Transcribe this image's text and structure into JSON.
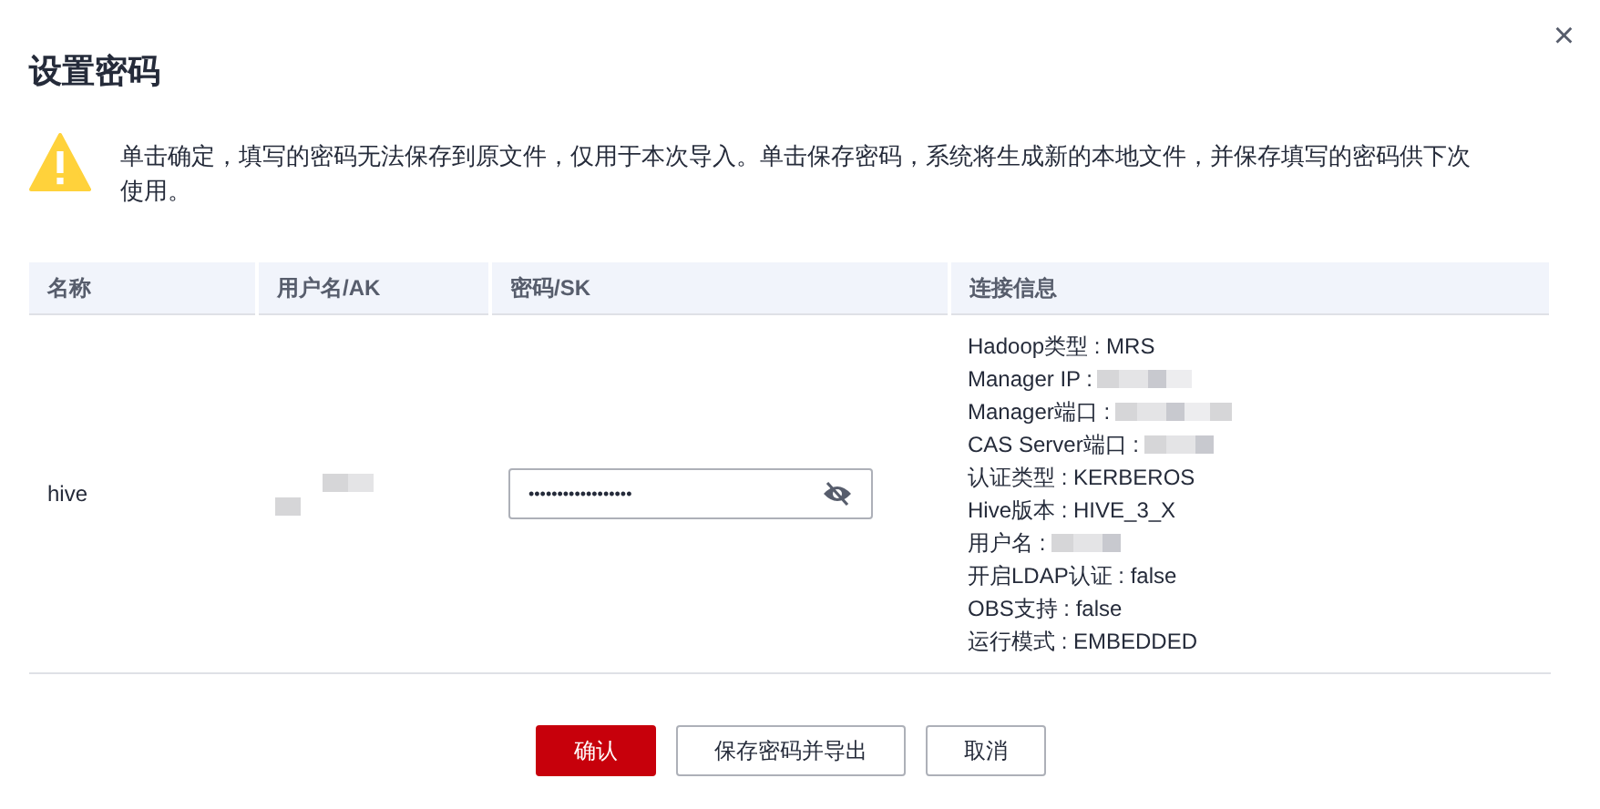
{
  "dialog": {
    "title": "设置密码",
    "close": "×"
  },
  "warning": {
    "text": "单击确定，填写的密码无法保存到原文件，仅用于本次导入。单击保存密码，系统将生成新的本地文件，并保存填写的密码供下次使用。"
  },
  "table": {
    "columns": [
      "名称",
      "用户名/AK",
      "密码/SK",
      "连接信息"
    ],
    "rows": [
      {
        "name": "hive",
        "username_redacted": true,
        "password": {
          "value": "••••••••••••••••••",
          "visible": false
        },
        "info": [
          {
            "text": "Hadoop类型 : MRS",
            "redacted": false
          },
          {
            "text": "Manager IP :",
            "redacted": true
          },
          {
            "text": "Manager端口 :",
            "redacted": true
          },
          {
            "text": "CAS Server端口 :",
            "redacted": true
          },
          {
            "text": "认证类型 : KERBEROS",
            "redacted": false
          },
          {
            "text": "Hive版本 : HIVE_3_X",
            "redacted": false
          },
          {
            "text": "用户名 :",
            "redacted": true
          },
          {
            "text": "开启LDAP认证 : false",
            "redacted": false
          },
          {
            "text": "OBS支持 : false",
            "redacted": false
          },
          {
            "text": "运行模式 : EMBEDDED",
            "redacted": false
          }
        ]
      }
    ]
  },
  "buttons": [
    {
      "label": "确认",
      "kind": "primary"
    },
    {
      "label": "保存密码并导出",
      "kind": "secondary"
    },
    {
      "label": "取消",
      "kind": "secondary"
    }
  ]
}
